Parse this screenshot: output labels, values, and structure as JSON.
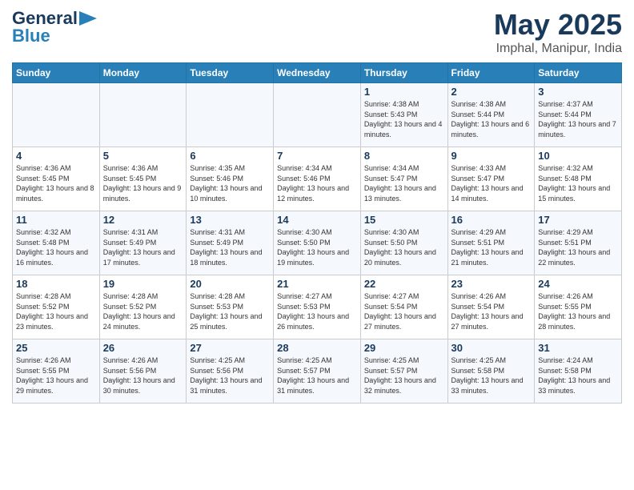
{
  "logo": {
    "line1": "General",
    "line2": "Blue"
  },
  "title": "May 2025",
  "location": "Imphal, Manipur, India",
  "days_of_week": [
    "Sunday",
    "Monday",
    "Tuesday",
    "Wednesday",
    "Thursday",
    "Friday",
    "Saturday"
  ],
  "weeks": [
    [
      {
        "day": "",
        "info": ""
      },
      {
        "day": "",
        "info": ""
      },
      {
        "day": "",
        "info": ""
      },
      {
        "day": "",
        "info": ""
      },
      {
        "day": "1",
        "info": "Sunrise: 4:38 AM\nSunset: 5:43 PM\nDaylight: 13 hours\nand 4 minutes."
      },
      {
        "day": "2",
        "info": "Sunrise: 4:38 AM\nSunset: 5:44 PM\nDaylight: 13 hours\nand 6 minutes."
      },
      {
        "day": "3",
        "info": "Sunrise: 4:37 AM\nSunset: 5:44 PM\nDaylight: 13 hours\nand 7 minutes."
      }
    ],
    [
      {
        "day": "4",
        "info": "Sunrise: 4:36 AM\nSunset: 5:45 PM\nDaylight: 13 hours\nand 8 minutes."
      },
      {
        "day": "5",
        "info": "Sunrise: 4:36 AM\nSunset: 5:45 PM\nDaylight: 13 hours\nand 9 minutes."
      },
      {
        "day": "6",
        "info": "Sunrise: 4:35 AM\nSunset: 5:46 PM\nDaylight: 13 hours\nand 10 minutes."
      },
      {
        "day": "7",
        "info": "Sunrise: 4:34 AM\nSunset: 5:46 PM\nDaylight: 13 hours\nand 12 minutes."
      },
      {
        "day": "8",
        "info": "Sunrise: 4:34 AM\nSunset: 5:47 PM\nDaylight: 13 hours\nand 13 minutes."
      },
      {
        "day": "9",
        "info": "Sunrise: 4:33 AM\nSunset: 5:47 PM\nDaylight: 13 hours\nand 14 minutes."
      },
      {
        "day": "10",
        "info": "Sunrise: 4:32 AM\nSunset: 5:48 PM\nDaylight: 13 hours\nand 15 minutes."
      }
    ],
    [
      {
        "day": "11",
        "info": "Sunrise: 4:32 AM\nSunset: 5:48 PM\nDaylight: 13 hours\nand 16 minutes."
      },
      {
        "day": "12",
        "info": "Sunrise: 4:31 AM\nSunset: 5:49 PM\nDaylight: 13 hours\nand 17 minutes."
      },
      {
        "day": "13",
        "info": "Sunrise: 4:31 AM\nSunset: 5:49 PM\nDaylight: 13 hours\nand 18 minutes."
      },
      {
        "day": "14",
        "info": "Sunrise: 4:30 AM\nSunset: 5:50 PM\nDaylight: 13 hours\nand 19 minutes."
      },
      {
        "day": "15",
        "info": "Sunrise: 4:30 AM\nSunset: 5:50 PM\nDaylight: 13 hours\nand 20 minutes."
      },
      {
        "day": "16",
        "info": "Sunrise: 4:29 AM\nSunset: 5:51 PM\nDaylight: 13 hours\nand 21 minutes."
      },
      {
        "day": "17",
        "info": "Sunrise: 4:29 AM\nSunset: 5:51 PM\nDaylight: 13 hours\nand 22 minutes."
      }
    ],
    [
      {
        "day": "18",
        "info": "Sunrise: 4:28 AM\nSunset: 5:52 PM\nDaylight: 13 hours\nand 23 minutes."
      },
      {
        "day": "19",
        "info": "Sunrise: 4:28 AM\nSunset: 5:52 PM\nDaylight: 13 hours\nand 24 minutes."
      },
      {
        "day": "20",
        "info": "Sunrise: 4:28 AM\nSunset: 5:53 PM\nDaylight: 13 hours\nand 25 minutes."
      },
      {
        "day": "21",
        "info": "Sunrise: 4:27 AM\nSunset: 5:53 PM\nDaylight: 13 hours\nand 26 minutes."
      },
      {
        "day": "22",
        "info": "Sunrise: 4:27 AM\nSunset: 5:54 PM\nDaylight: 13 hours\nand 27 minutes."
      },
      {
        "day": "23",
        "info": "Sunrise: 4:26 AM\nSunset: 5:54 PM\nDaylight: 13 hours\nand 27 minutes."
      },
      {
        "day": "24",
        "info": "Sunrise: 4:26 AM\nSunset: 5:55 PM\nDaylight: 13 hours\nand 28 minutes."
      }
    ],
    [
      {
        "day": "25",
        "info": "Sunrise: 4:26 AM\nSunset: 5:55 PM\nDaylight: 13 hours\nand 29 minutes."
      },
      {
        "day": "26",
        "info": "Sunrise: 4:26 AM\nSunset: 5:56 PM\nDaylight: 13 hours\nand 30 minutes."
      },
      {
        "day": "27",
        "info": "Sunrise: 4:25 AM\nSunset: 5:56 PM\nDaylight: 13 hours\nand 31 minutes."
      },
      {
        "day": "28",
        "info": "Sunrise: 4:25 AM\nSunset: 5:57 PM\nDaylight: 13 hours\nand 31 minutes."
      },
      {
        "day": "29",
        "info": "Sunrise: 4:25 AM\nSunset: 5:57 PM\nDaylight: 13 hours\nand 32 minutes."
      },
      {
        "day": "30",
        "info": "Sunrise: 4:25 AM\nSunset: 5:58 PM\nDaylight: 13 hours\nand 33 minutes."
      },
      {
        "day": "31",
        "info": "Sunrise: 4:24 AM\nSunset: 5:58 PM\nDaylight: 13 hours\nand 33 minutes."
      }
    ]
  ]
}
